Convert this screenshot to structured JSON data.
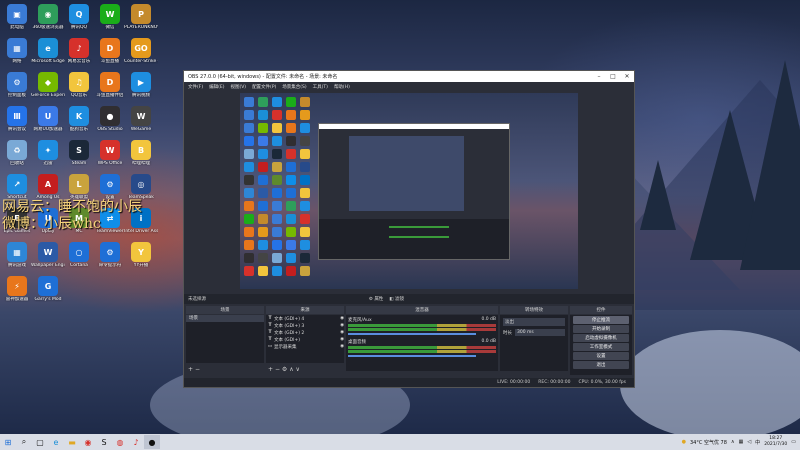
{
  "desktop": {
    "icons": [
      {
        "label": "此电脑",
        "glyph": "▣",
        "color": "#3a7bd5"
      },
      {
        "label": "360极速浏览器",
        "glyph": "◉",
        "color": "#2e9e5b"
      },
      {
        "label": "腾讯QQ",
        "glyph": "Q",
        "color": "#1e8ee0"
      },
      {
        "label": "微信",
        "glyph": "W",
        "color": "#1aad19"
      },
      {
        "label": "PLAYERUNKNOWN'S BATTLEGROUNDS",
        "glyph": "P",
        "color": "#c48a2c"
      },
      {
        "label": "网络",
        "glyph": "▦",
        "color": "#3a7bd5"
      },
      {
        "label": "Microsoft Edge",
        "glyph": "e",
        "color": "#1b8fd6"
      },
      {
        "label": "网易云音乐",
        "glyph": "♪",
        "color": "#d6312b"
      },
      {
        "label": "斗鱼直播",
        "glyph": "D",
        "color": "#e8761c"
      },
      {
        "label": "Counter-Strike Global Offensive",
        "glyph": "GO",
        "color": "#e59a1c"
      },
      {
        "label": "控制面板",
        "glyph": "⚙",
        "color": "#3a7bd5"
      },
      {
        "label": "GeForce Experience",
        "glyph": "◆",
        "color": "#76b900"
      },
      {
        "label": "QQ音乐",
        "glyph": "♫",
        "color": "#f2c53d"
      },
      {
        "label": "斗鱼直播伴侣",
        "glyph": "D",
        "color": "#e8761c"
      },
      {
        "label": "腾讯视频",
        "glyph": "▶",
        "color": "#1e8ee0"
      },
      {
        "label": "腾讯会议",
        "glyph": "Ⅲ",
        "color": "#2573e8"
      },
      {
        "label": "网易UU加速器",
        "glyph": "U",
        "color": "#3b7ae8"
      },
      {
        "label": "酷狗音乐",
        "glyph": "K",
        "color": "#1e8ee0"
      },
      {
        "label": "OBS Studio",
        "glyph": "●",
        "color": "#302e31"
      },
      {
        "label": "WeGame",
        "glyph": "W",
        "color": "#444"
      },
      {
        "label": "回收站",
        "glyph": "♻",
        "color": "#7aa9d6"
      },
      {
        "label": "迅雷",
        "glyph": "✦",
        "color": "#1e8ee0"
      },
      {
        "label": "Steam",
        "glyph": "S",
        "color": "#1b2838"
      },
      {
        "label": "WPS Office",
        "glyph": "W",
        "color": "#d6312b"
      },
      {
        "label": "哔哩哔哩",
        "glyph": "B",
        "color": "#f2c53d"
      },
      {
        "label": "Shortcut",
        "glyph": "↗",
        "color": "#1e8ee0"
      },
      {
        "label": "Among Us",
        "glyph": "A",
        "color": "#c41e1e"
      },
      {
        "label": "英雄联盟",
        "glyph": "L",
        "color": "#c9a33d"
      },
      {
        "label": "设置",
        "glyph": "⚙",
        "color": "#1e6fd6"
      },
      {
        "label": "TeamSpeak",
        "glyph": "◎",
        "color": "#274a8a"
      },
      {
        "label": "Epic Games",
        "glyph": "E",
        "color": "#333"
      },
      {
        "label": "Uplay",
        "glyph": "U",
        "color": "#1e6fd6"
      },
      {
        "label": "MC",
        "glyph": "M",
        "color": "#5e8a2c"
      },
      {
        "label": "TeamViewer",
        "glyph": "⇄",
        "color": "#0e8ee9"
      },
      {
        "label": "Intel Driver Assistant",
        "glyph": "i",
        "color": "#0071c5"
      },
      {
        "label": "腾讯游戏",
        "glyph": "▦",
        "color": "#2e86d6"
      },
      {
        "label": "Wallpaper Engine",
        "glyph": "W",
        "color": "#2b5aa6"
      },
      {
        "label": "Cortana",
        "glyph": "○",
        "color": "#1e6fd6"
      },
      {
        "label": "命令提示符",
        "glyph": "⚙",
        "color": "#1e6fd6"
      },
      {
        "label": "YY开播",
        "glyph": "Y",
        "color": "#f2c53d"
      },
      {
        "label": "雷神加速器",
        "glyph": "⚡",
        "color": "#e8761c"
      },
      {
        "label": "Garry's Mod",
        "glyph": "G",
        "color": "#1e6fd6"
      }
    ],
    "overlay": {
      "line1": "网易云：睡不饱的小辰",
      "line2": "微博：小辰whc"
    }
  },
  "obs": {
    "title": "OBS 27.0.0 (64-bit, windows) - 配置文件: 未命名 - 场景: 未命名",
    "menu": [
      "文件(F)",
      "编辑(E)",
      "视图(V)",
      "配置文件(P)",
      "场景集合(S)",
      "工具(T)",
      "帮助(H)"
    ],
    "source_toolbar": {
      "status": "未选择源",
      "properties": "属性",
      "filters": "滤镜"
    },
    "panels": {
      "scenes": {
        "title": "场景",
        "items": [
          "场景"
        ]
      },
      "sources": {
        "title": "来源",
        "items": [
          "文本 (GDI+) 4",
          "文本 (GDI+) 3",
          "文本 (GDI+) 2",
          "文本 (GDI+)",
          "显示器采集"
        ]
      },
      "mixer": {
        "title": "混音器",
        "channels": [
          {
            "name": "麦克风/Aux",
            "db": "0.0 dB"
          },
          {
            "name": "桌面音频",
            "db": "0.0 dB"
          }
        ]
      },
      "transitions": {
        "title": "转场特效",
        "type": "淡出",
        "duration_label": "时长",
        "duration": "300 ms"
      },
      "controls": {
        "title": "控件",
        "buttons": [
          "停止推流",
          "开始录制",
          "启动虚拟摄像机",
          "工作室模式",
          "设置",
          "退出"
        ]
      }
    },
    "status": {
      "live": "LIVE: 00:00:00",
      "rec": "REC: 00:00:00",
      "cpu": "CPU: 0.0%, 30.00 fps"
    }
  },
  "taskbar": {
    "weather": "34°C 空气优 78",
    "time": "18:27",
    "date": "2021/7/30",
    "ime": "中"
  },
  "colors": {
    "obs_bg": "#2b2e38",
    "panel_bg": "#1e2028",
    "taskbar": "#d9dde6"
  }
}
